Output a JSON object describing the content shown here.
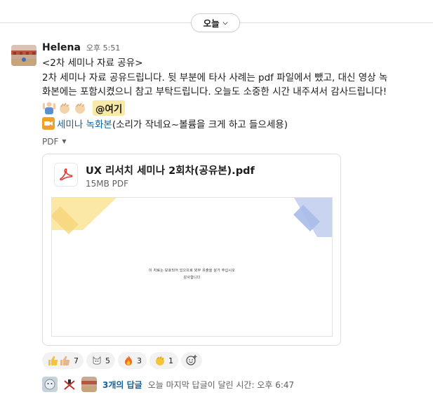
{
  "day_divider": {
    "label": "오늘"
  },
  "message": {
    "author": "Helena",
    "time": "오후 5:51",
    "title_line": "<2차 세미나 자료 공유>",
    "body_line1": "2차 세미나 자료 공유드립니다. 뒷 부분에 타사 사례는 pdf 파일에서 뺐고, 대신 영상 녹",
    "body_line2": "화본에는 포함시켰으니 참고 부탁드립니다. 오늘도 소중한 시간 내주셔서 감사드립니다!",
    "mention": "@여기",
    "recording_link": "세미나 녹화본",
    "recording_note": " (소리가 작네요~볼륨을 크게 하고 들으세용)",
    "attachment_type_label": "PDF"
  },
  "file": {
    "name": "UX 리서치 세미나 2회차(공유본).pdf",
    "meta": "15MB PDF",
    "preview_line1": "이 자료는 보호되어 있으므로 외부 유출을 삼가 주십시오",
    "preview_line2": "감사합니다"
  },
  "reactions": [
    {
      "icon": "thumbs-up-icon",
      "count": "7"
    },
    {
      "icon": "cat-face-icon",
      "count": "5"
    },
    {
      "icon": "fire-icon",
      "count": "3"
    },
    {
      "icon": "clap-icon",
      "count": "1"
    }
  ],
  "thread": {
    "reply_count": "3개의 답글",
    "last_reply": "오늘 마지막 답글이 달린 시간: 오후 6:47"
  },
  "colors": {
    "link": "#1264a3",
    "mention_bg": "#f8e9a6",
    "pdf_red": "#d93a32",
    "muted": "#616061"
  }
}
